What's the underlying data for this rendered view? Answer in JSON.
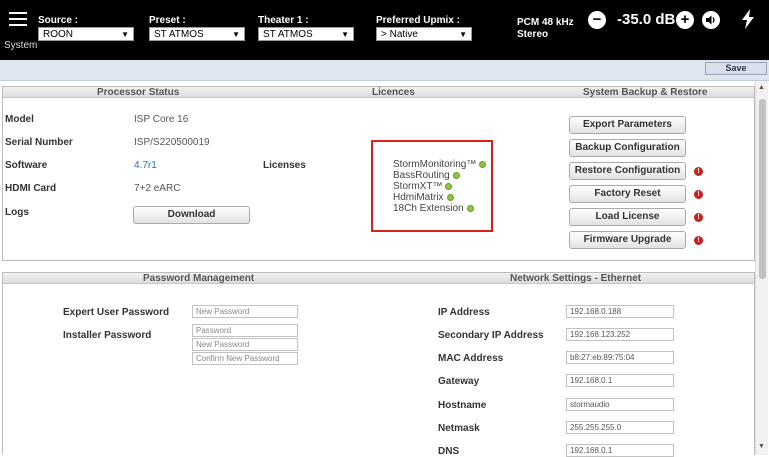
{
  "topbar": {
    "system_label": "System",
    "source": {
      "label": "Source :",
      "value": "ROON"
    },
    "preset": {
      "label": "Preset :",
      "value": "ST ATMOS"
    },
    "theater": {
      "label": "Theater 1 :",
      "value": "ST ATMOS"
    },
    "upmix": {
      "label": "Preferred Upmix :",
      "value": "> Native"
    },
    "status_line1": "PCM 48 kHz",
    "status_line2": "Stereo",
    "minus_symbol": "−",
    "plus_symbol": "+",
    "volume": "-35.0 dB",
    "icons": [
      "hamburger-icon",
      "minus-icon",
      "plus-icon",
      "speaker-icon",
      "power-icon"
    ]
  },
  "save_label": "Save",
  "processor": {
    "title": "Processor Status",
    "model_label": "Model",
    "model": "ISP Core 16",
    "serial_label": "Serial Number",
    "serial": "ISP/S220500019",
    "software_label": "Software",
    "software": "4.7r1",
    "hdmi_label": "HDMI Card",
    "hdmi": "7+2 eARC",
    "logs_label": "Logs",
    "download_label": "Download"
  },
  "licences": {
    "title": "Licences",
    "label": "Licenses",
    "items": [
      "StormMonitoring™",
      "BassRouting",
      "StormXT™",
      "HdmiMatrix",
      "18Ch Extension"
    ]
  },
  "backup": {
    "title": "System Backup & Restore",
    "buttons": [
      "Export Parameters",
      "Backup Configuration",
      "Restore Configuration",
      "Factory Reset",
      "Load License",
      "Firmware Upgrade"
    ],
    "warning_symbol": "!"
  },
  "password": {
    "title": "Password Management",
    "expert_label": "Expert User Password",
    "expert_placeholder": "New Password",
    "installer_label": "Installer Password",
    "installer_current_placeholder": "Password",
    "installer_new_placeholder": "New Password",
    "installer_confirm_placeholder": "Confirm New Password"
  },
  "network": {
    "title": "Network Settings - Ethernet",
    "ip_label": "IP Address",
    "ip": "192.168.0.188",
    "secondary_label": "Secondary IP Address",
    "secondary": "192.168.123.252",
    "mac_label": "MAC Address",
    "mac": "b8:27:eb:89:75:04",
    "gateway_label": "Gateway",
    "gateway": "192.168.0.1",
    "hostname_label": "Hostname",
    "hostname": "stormaudio",
    "netmask_label": "Netmask",
    "netmask": "255.255.255.0",
    "dns_label": "DNS",
    "dns": "192.168.0.1"
  },
  "colors": {
    "topbar": "#000000",
    "highlight": "#d9201c",
    "license_ok": "#8cc63e",
    "warning": "#cc1f1f",
    "link": "#2a6fb8"
  }
}
